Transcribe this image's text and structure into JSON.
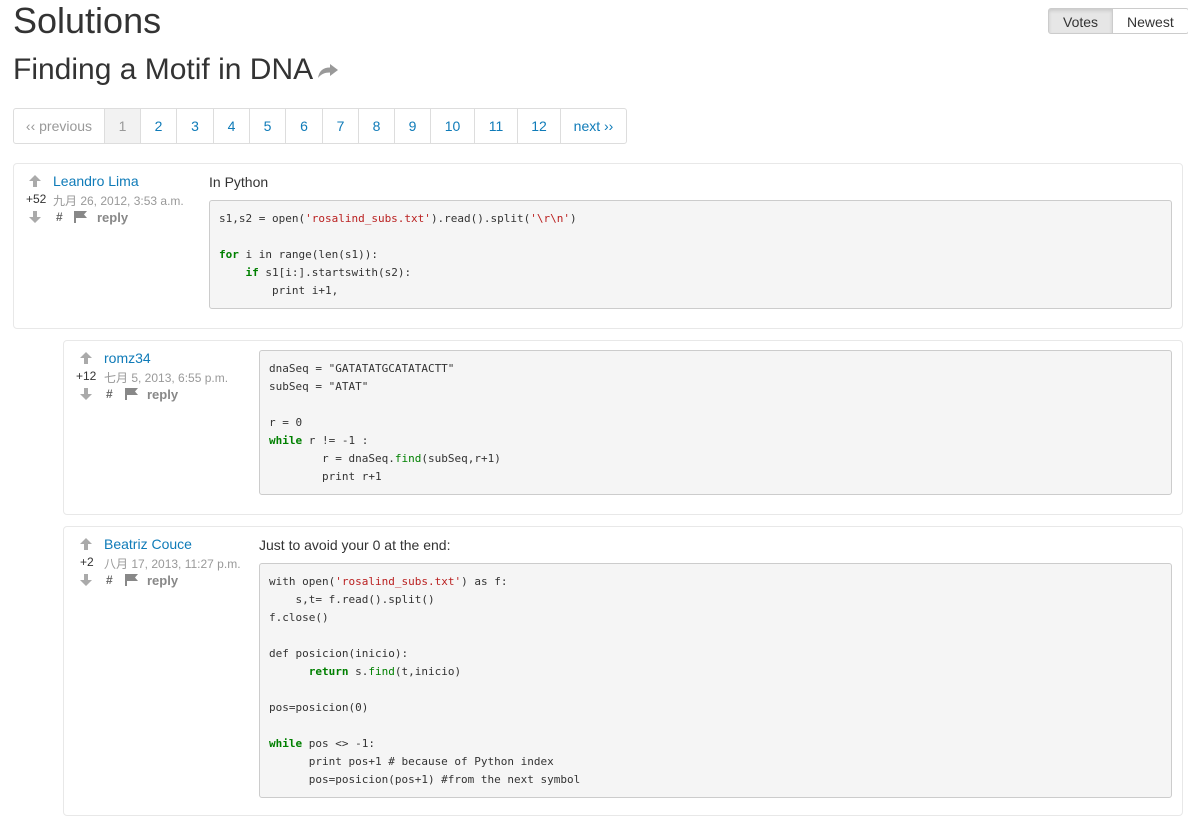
{
  "page": {
    "title": "Solutions",
    "problem_title": "Finding a Motif in DNA"
  },
  "sort": {
    "votes": "Votes",
    "newest": "Newest"
  },
  "pager": {
    "prev": "‹‹ previous",
    "pages": [
      "1",
      "2",
      "3",
      "4",
      "5",
      "6",
      "7",
      "8",
      "9",
      "10",
      "11",
      "12"
    ],
    "next": "next ››"
  },
  "solutions": [
    {
      "author": "Leandro Lima",
      "votes": "+52",
      "date": "九月 26, 2012, 3:53 a.m.",
      "hash": "#",
      "reply": "reply",
      "text": "In Python",
      "code": [
        [
          [
            "s1,s2 = open(",
            ""
          ],
          [
            "'rosalind_subs.txt'",
            "str"
          ],
          [
            ").read().split(",
            ""
          ],
          [
            "'\\r\\n'",
            "str"
          ],
          [
            ")",
            ""
          ]
        ],
        [],
        [
          [
            "for",
            "kw"
          ],
          [
            " i in range(len(s1)):",
            ""
          ]
        ],
        [
          [
            "    ",
            ""
          ],
          [
            "if",
            "kw"
          ],
          [
            " s1[i:].startswith(s2):",
            ""
          ]
        ],
        [
          [
            "        print i+1,",
            ""
          ]
        ]
      ]
    },
    {
      "author": "romz34",
      "votes": "+12",
      "date": "七月 5, 2013, 6:55 p.m.",
      "hash": "#",
      "reply": "reply",
      "text": "",
      "code": [
        [
          [
            "dnaSeq = \"GATATATGCATATACTT\"",
            ""
          ]
        ],
        [
          [
            "subSeq = \"ATAT\"",
            ""
          ]
        ],
        [],
        [
          [
            "r = 0",
            ""
          ]
        ],
        [
          [
            "while",
            "kw"
          ],
          [
            " r != -1 :",
            ""
          ]
        ],
        [
          [
            "        r = dnaSeq.",
            ""
          ],
          [
            "find",
            "fn"
          ],
          [
            "(subSeq,r+1)",
            ""
          ]
        ],
        [
          [
            "        print r+1",
            ""
          ]
        ]
      ]
    },
    {
      "author": "Beatriz Couce",
      "votes": "+2",
      "date": "八月 17, 2013, 11:27 p.m.",
      "hash": "#",
      "reply": "reply",
      "text": "Just to avoid your 0 at the end:",
      "code": [
        [
          [
            "with open(",
            ""
          ],
          [
            "'rosalind_subs.txt'",
            "str"
          ],
          [
            ") as f:",
            ""
          ]
        ],
        [
          [
            "    s,t= f.read().split()",
            ""
          ]
        ],
        [
          [
            "f.close()",
            ""
          ]
        ],
        [],
        [
          [
            "def posicion(inicio):",
            ""
          ]
        ],
        [
          [
            "      ",
            ""
          ],
          [
            "return",
            "kw"
          ],
          [
            " s.",
            ""
          ],
          [
            "find",
            "fn"
          ],
          [
            "(t,inicio)",
            ""
          ]
        ],
        [],
        [
          [
            "pos=posicion(0)",
            ""
          ]
        ],
        [],
        [
          [
            "while",
            "kw"
          ],
          [
            " pos <> -1:",
            ""
          ]
        ],
        [
          [
            "      print pos+1 # because of Python index",
            ""
          ]
        ],
        [
          [
            "      pos=posicion(pos+1) #from the next symbol",
            ""
          ]
        ]
      ]
    }
  ],
  "colors": {
    "link": "#0f7bb8",
    "muted": "#999999",
    "code_bg": "#f5f5f5"
  },
  "icons": {
    "upvote": "arrow-up-icon",
    "downvote": "arrow-down-icon",
    "flag": "flag-icon",
    "share": "share-icon"
  }
}
